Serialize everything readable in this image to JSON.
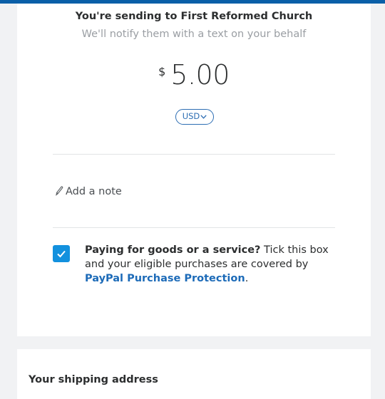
{
  "header": {
    "bar_color": "#0a5fa8"
  },
  "transfer": {
    "recipient_line": "You're sending to First Reformed Church",
    "notify_line": "We'll notify them with a text on your behalf",
    "currency_symbol": "$",
    "amount": "5.00",
    "currency_code": "USD",
    "currency_chevron_icon": "chevron-down-icon"
  },
  "note": {
    "icon": "pencil-icon",
    "label": "Add a note"
  },
  "purchase_protection": {
    "checked": true,
    "question": "Paying for goods or a service?",
    "body_1": " Tick this box and your eligible purchases are covered by ",
    "link": "PayPal Purchase Protection",
    "end": ".",
    "checkbox_color": "#1391de",
    "link_color": "#1d6bb8"
  },
  "shipping": {
    "title": "Your shipping address"
  }
}
